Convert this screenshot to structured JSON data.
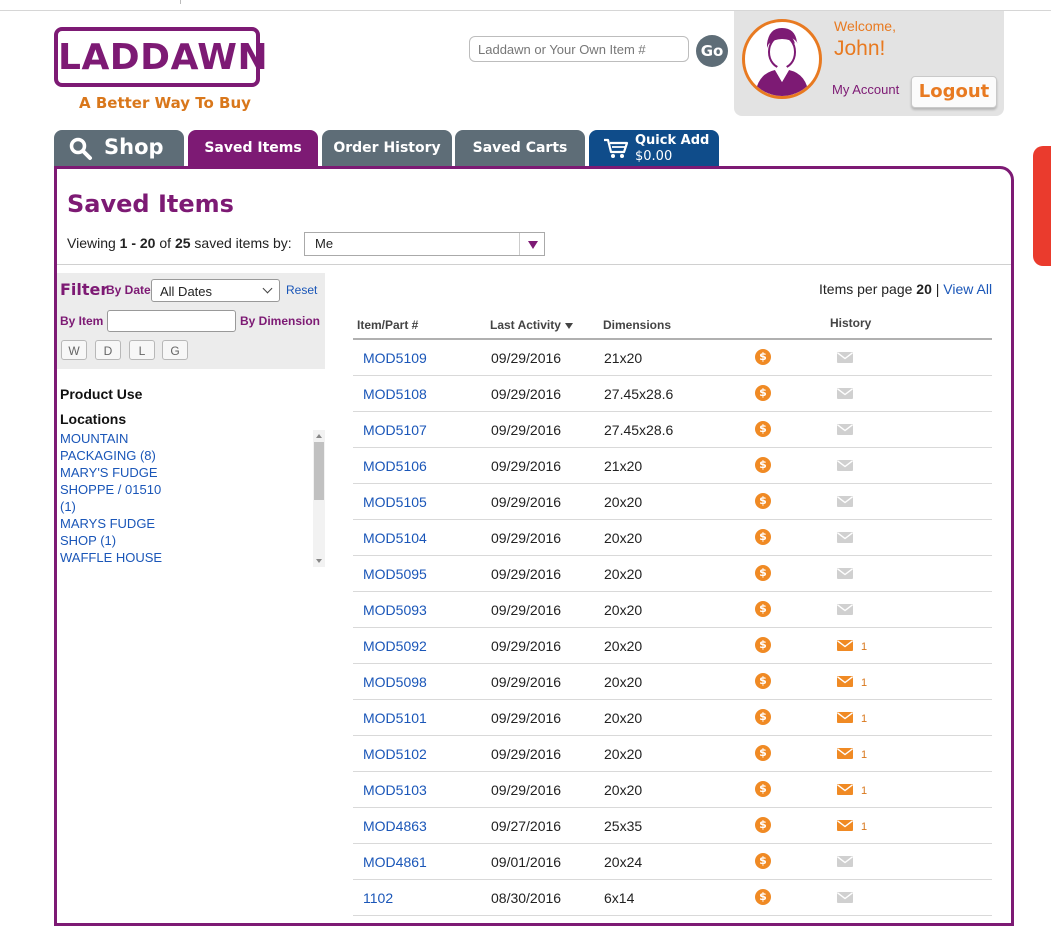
{
  "brand": {
    "logo_text": "LADDAWN",
    "tagline": "A Better Way To Buy"
  },
  "search": {
    "placeholder": "Laddawn or Your Own Item #",
    "go_label": "Go"
  },
  "account": {
    "welcome": "Welcome,",
    "name": "John!",
    "my_account": "My Account",
    "logout": "Logout"
  },
  "nav": {
    "shop": "Shop",
    "saved_items": "Saved Items",
    "order_history": "Order History",
    "saved_carts": "Saved Carts",
    "quick_add": "Quick Add",
    "quick_add_total": "$0.00"
  },
  "page": {
    "title": "Saved Items",
    "viewing_prefix": "Viewing",
    "range": "1 - 20",
    "of": "of",
    "total": "25",
    "viewing_suffix": "saved items by:",
    "by_value": "Me"
  },
  "filter": {
    "label": "Filter",
    "by_date_label": "By Date",
    "date_value": "All Dates",
    "reset": "Reset",
    "by_item_label": "By Item",
    "by_dimension_label": "By Dimension",
    "dim_buttons": [
      "W",
      "D",
      "L",
      "G"
    ],
    "product_use": "Product Use",
    "locations_title": "Locations",
    "locations": [
      "MOUNTAIN",
      "PACKAGING (8)",
      "MARY'S FUDGE",
      "SHOPPE / 01510",
      "(1)",
      "MARYS FUDGE",
      "SHOP (1)",
      "WAFFLE HOUSE"
    ]
  },
  "paging": {
    "label": "Items per page",
    "value": "20",
    "separator": "|",
    "view_all": "View All"
  },
  "table": {
    "headers": {
      "item": "Item/Part #",
      "last_activity": "Last Activity",
      "dimensions": "Dimensions",
      "history": "History"
    },
    "price_icon": "dollar-coin-icon",
    "rows": [
      {
        "item": "MOD5109",
        "date": "09/29/2016",
        "dim": "21x20",
        "history": ""
      },
      {
        "item": "MOD5108",
        "date": "09/29/2016",
        "dim": "27.45x28.6",
        "history": ""
      },
      {
        "item": "MOD5107",
        "date": "09/29/2016",
        "dim": "27.45x28.6",
        "history": ""
      },
      {
        "item": "MOD5106",
        "date": "09/29/2016",
        "dim": "21x20",
        "history": ""
      },
      {
        "item": "MOD5105",
        "date": "09/29/2016",
        "dim": "20x20",
        "history": ""
      },
      {
        "item": "MOD5104",
        "date": "09/29/2016",
        "dim": "20x20",
        "history": ""
      },
      {
        "item": "MOD5095",
        "date": "09/29/2016",
        "dim": "20x20",
        "history": ""
      },
      {
        "item": "MOD5093",
        "date": "09/29/2016",
        "dim": "20x20",
        "history": ""
      },
      {
        "item": "MOD5092",
        "date": "09/29/2016",
        "dim": "20x20",
        "history": "1"
      },
      {
        "item": "MOD5098",
        "date": "09/29/2016",
        "dim": "20x20",
        "history": "1"
      },
      {
        "item": "MOD5101",
        "date": "09/29/2016",
        "dim": "20x20",
        "history": "1"
      },
      {
        "item": "MOD5102",
        "date": "09/29/2016",
        "dim": "20x20",
        "history": "1"
      },
      {
        "item": "MOD5103",
        "date": "09/29/2016",
        "dim": "20x20",
        "history": "1"
      },
      {
        "item": "MOD4863",
        "date": "09/27/2016",
        "dim": "25x35",
        "history": "1"
      },
      {
        "item": "MOD4861",
        "date": "09/01/2016",
        "dim": "20x24",
        "history": ""
      },
      {
        "item": "1102",
        "date": "08/30/2016",
        "dim": "6x14",
        "history": ""
      }
    ]
  },
  "colors": {
    "brand_purple": "#7d1a74",
    "brand_orange": "#e87a21",
    "tab_gray": "#5e6d77",
    "quick_add_blue": "#0f4c8a",
    "link_blue": "#1a56b8",
    "history_active": "#f08a24",
    "history_inactive": "#d0d0d0"
  }
}
